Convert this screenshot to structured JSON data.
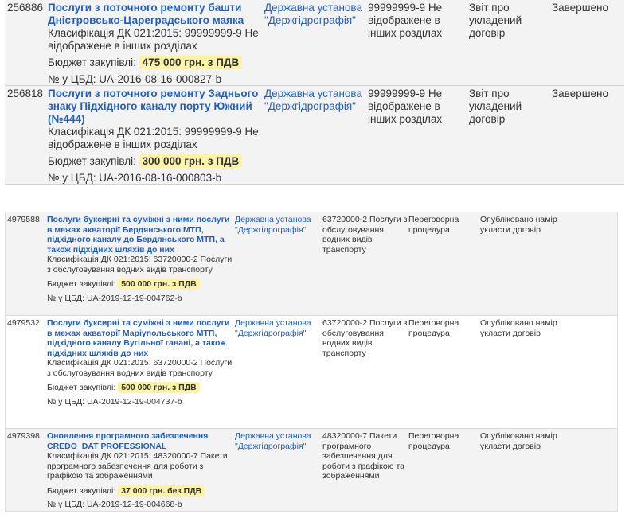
{
  "top_rows": [
    {
      "id": "256886",
      "title": "Послуги з поточного ремонту башти Дністровсько-Цареградського маяка",
      "classification": "Класифікація ДК 021:2015: 99999999-9 Не відображене в інших розділах",
      "budget_label": "Бюджет закупівлі:",
      "budget_amount": "475 000 грн. з ПДВ",
      "cbd": "№ у ЦБД: UA-2016-08-16-000827-b",
      "org": "Державна установа \"Держгідрографія\"",
      "cls_short": "99999999-9 Не відображене в інших розділах",
      "procedure": "Звіт про укладений договір",
      "status": "Завершено"
    },
    {
      "id": "256818",
      "title": "Послуги з поточного ремонту Заднього знаку Підхідного каналу порту Южний (№444)",
      "classification": "Класифікація ДК 021:2015: 99999999-9 Не відображене в інших розділах",
      "budget_label": "Бюджет закупівлі:",
      "budget_amount": "300 000 грн. з ПДВ",
      "cbd": "№ у ЦБД: UA-2016-08-16-000803-b",
      "org": "Державна установа \"Держгідрографія\"",
      "cls_short": "99999999-9 Не відображене в інших розділах",
      "procedure": "Звіт про укладений договір",
      "status": "Завершено"
    }
  ],
  "bottom_rows": [
    {
      "id": "4979588",
      "title": "Послуги буксирні та суміжні з ними послуги в межах акваторії Бердянського МТП, підхідного каналу до Бердянського МТП, а також підхідних шляхів до них",
      "classification": "Класифікація ДК 021:2015: 63720000-2 Послуги з обслуговування водних видів транспорту",
      "budget_label": "Бюджет закупівлі:",
      "budget_amount": "500 000 грн. з ПДВ",
      "cbd": "№ у ЦБД: UA-2019-12-19-004762-b",
      "org": "Державна установа \"Держгідрографія\"",
      "cls_short": "63720000-2 Послуги з обслуговування водних видів транспорту",
      "procedure": "Переговорна процедура",
      "status": "Опубліковано намір укласти договір"
    },
    {
      "id": "4979532",
      "title": "Послуги буксирні та суміжні з ними послуги в межах акваторії Маріупольського МТП, підхідного каналу Вугільної гавані, а також підхідних шляхів до них",
      "classification": "Класифікація ДК 021:2015: 63720000-2 Послуги з обслуговування водних видів транспорту",
      "budget_label": "Бюджет закупівлі:",
      "budget_amount": "500 000 грн. з ПДВ",
      "cbd": "№ у ЦБД: UA-2019-12-19-004737-b",
      "org": "Державна установа \"Держгідрографія\"",
      "cls_short": "63720000-2 Послуги з обслуговування водних видів транспорту",
      "procedure": "Переговорна процедура",
      "status": "Опубліковано намір укласти договір"
    },
    {
      "id": "4979398",
      "title": "Оновлення програмного забезпечення CREDO_DAT PROFESSIONAL",
      "classification": "Класифікація ДК 021:2015: 48320000-7 Пакети програмного забезпечення для роботи з графікою та зображеннями",
      "budget_label": "Бюджет закупівлі:",
      "budget_amount": "37 000 грн. без ПДВ",
      "cbd": "№ у ЦБД: UA-2019-12-19-004668-b",
      "org": "Державна установа \"Держгідрографія\"",
      "cls_short": "48320000-7 Пакети програмного забезпечення для роботи з графікою та зображеннями",
      "procedure": "Переговорна процедура",
      "status": "Опубліковано намір укласти договір"
    }
  ],
  "colors": {
    "link": "#1f5fc4",
    "highlight": "#fdf3a6",
    "row_bg": "#f3f3f3"
  }
}
